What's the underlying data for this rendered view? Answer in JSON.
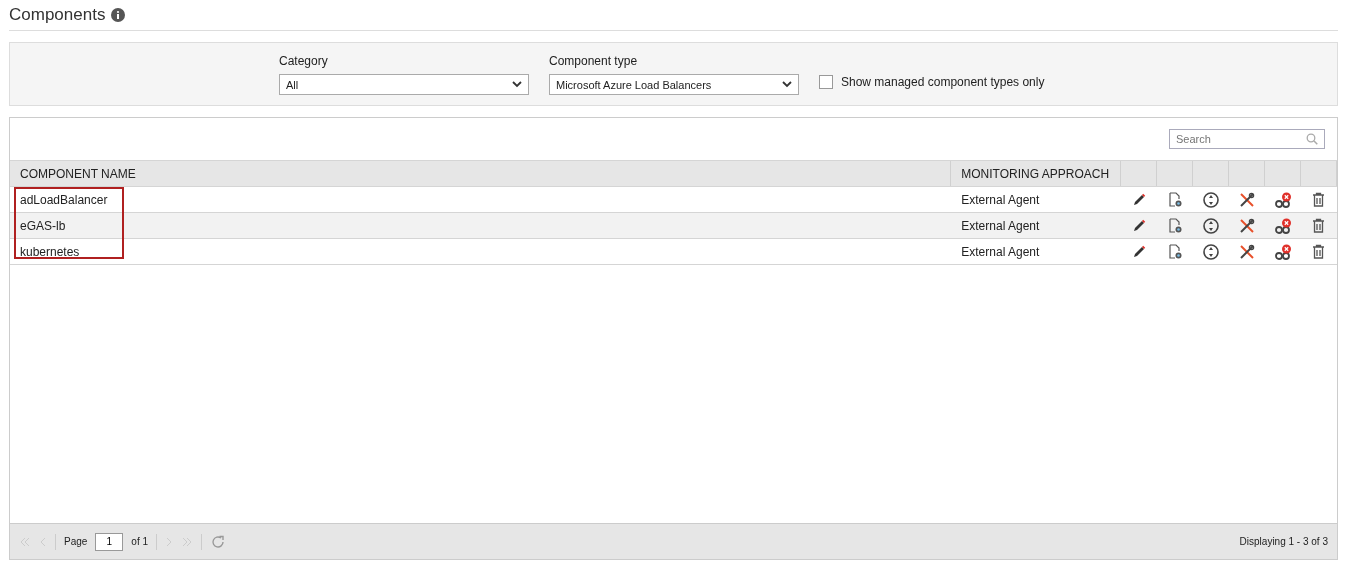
{
  "title": "Components",
  "filters": {
    "category": {
      "label": "Category",
      "value": "All"
    },
    "component_type": {
      "label": "Component type",
      "value": "Microsoft Azure Load Balancers"
    },
    "managed_only": {
      "label": "Show managed component types only",
      "checked": false
    }
  },
  "search": {
    "placeholder": "Search"
  },
  "table": {
    "columns": [
      "COMPONENT NAME",
      "MONITORING APPROACH"
    ],
    "rows": [
      {
        "name": "adLoadBalancer",
        "approach": "External Agent"
      },
      {
        "name": "eGAS-lb",
        "approach": "External Agent"
      },
      {
        "name": "kubernetes",
        "approach": "External Agent"
      }
    ]
  },
  "pager": {
    "page_label": "Page",
    "page": "1",
    "of": "of 1",
    "status": "Displaying 1 - 3 of 3"
  }
}
